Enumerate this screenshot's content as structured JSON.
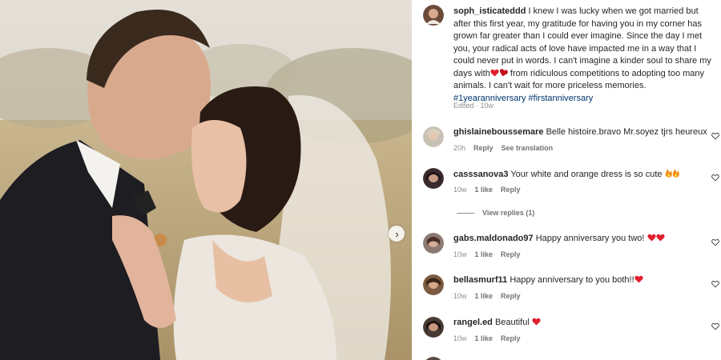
{
  "post": {
    "username": "soph_isticateddd",
    "caption": "I knew I was lucky when we got married but after this first year, my gratitude for having you in my corner has grown far greater than I could ever imagine. Since the day I met you, your radical acts of love have impacted me in a way that I could never put in words. I can't imagine a kinder soul to share my days with",
    "caption_tail": "from ridiculous competitions to adopting too many animals. I can't wait for more priceless memories.",
    "hashtags": "#1yearanniversary #firstanniversary",
    "edited": "Edited · 10w"
  },
  "comments": [
    {
      "username": "ghislaineboussemare",
      "text": "Belle histoire.bravo Mr.soyez tjrs heureux",
      "time": "20h",
      "likes": "",
      "reply": "Reply",
      "translate": "See translation",
      "emoji": ""
    },
    {
      "username": "casssanova3",
      "text": "Your white and orange dress is so cute",
      "time": "10w",
      "likes": "1 like",
      "reply": "Reply",
      "emoji": "flames"
    },
    {
      "username": "gabs.maldonado97",
      "text": "Happy anniversary you two!",
      "time": "10w",
      "likes": "1 like",
      "reply": "Reply",
      "emoji": "hearts2"
    },
    {
      "username": "bellasmurf11",
      "text": "Happy anniversary to you both!!",
      "time": "10w",
      "likes": "1 like",
      "reply": "Reply",
      "emoji": "heart1"
    },
    {
      "username": "rangel.ed",
      "text": "Beautiful",
      "time": "10w",
      "likes": "1 like",
      "reply": "Reply",
      "emoji": "heart1"
    }
  ],
  "view_replies": "View replies (1)",
  "icons": {
    "next": "chevron-right-icon",
    "like": "heart-outline-icon",
    "emoji_heart": "red-heart-emoji",
    "emoji_fire": "fire-emoji"
  },
  "colors": {
    "link": "#00376b",
    "heart": "#e0202e",
    "meta": "#8e8e8e"
  }
}
